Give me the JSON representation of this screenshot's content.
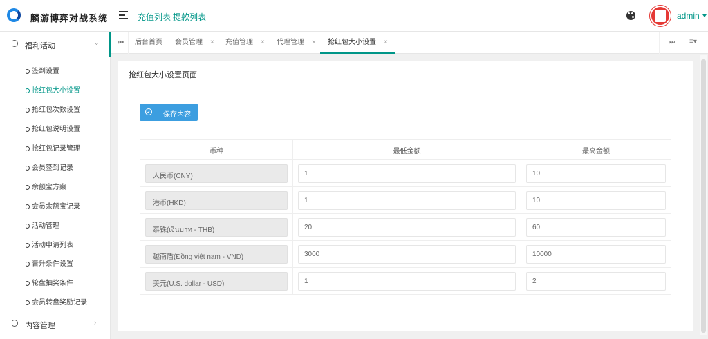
{
  "header": {
    "system_title": "麟游博弈对战系统",
    "links": [
      "充值列表",
      "提款列表"
    ],
    "user": "admin",
    "accent": "#009688"
  },
  "sidebar": {
    "groups": [
      {
        "label": "福利活动",
        "expanded": true
      },
      {
        "label": "内容管理",
        "expanded": false
      }
    ],
    "items": [
      "签到设置",
      "抢红包大小设置",
      "抢红包次数设置",
      "抢红包说明设置",
      "抢红包记录管理",
      "会员签到记录",
      "余额宝方案",
      "会员余额宝记录",
      "活动管理",
      "活动申请列表",
      "晋升条件设置",
      "轮盘抽奖条件",
      "会员转盘奖励记录"
    ],
    "active_item": "抢红包大小设置"
  },
  "tabs": {
    "items": [
      "后台首页",
      "会员管理",
      "充值管理",
      "代理管理",
      "抢红包大小设置"
    ],
    "active": "抢红包大小设置",
    "close_symbol": "×"
  },
  "page": {
    "title": "抢红包大小设置页面",
    "save_label": "保存内容",
    "save_color": "#3c9ee0"
  },
  "table": {
    "headers": [
      "币种",
      "最低金额",
      "最高金额"
    ],
    "rows": [
      {
        "currency": "人民币(CNY)",
        "min": "1",
        "max": "10"
      },
      {
        "currency": "港币(HKD)",
        "min": "1",
        "max": "10"
      },
      {
        "currency": "泰铢(เงินบาท - THB)",
        "min": "20",
        "max": "60"
      },
      {
        "currency": "越南盾(Đồng việt nam - VND)",
        "min": "3000",
        "max": "10000"
      },
      {
        "currency": "美元(U.S. dollar - USD)",
        "min": "1",
        "max": "2"
      }
    ]
  }
}
